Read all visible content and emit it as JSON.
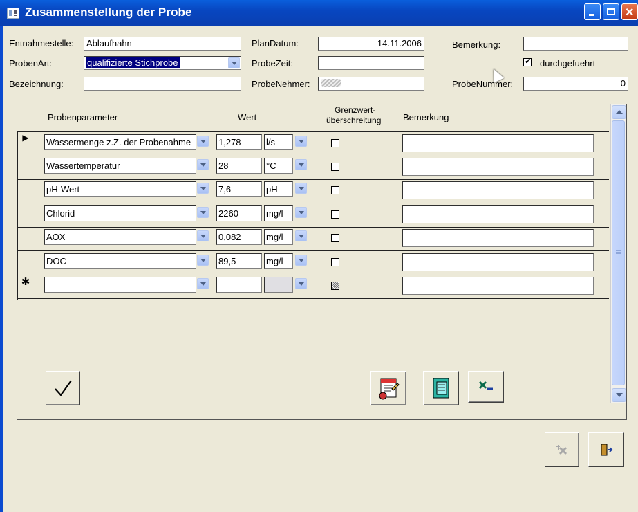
{
  "window": {
    "title": "Zusammenstellung der Probe"
  },
  "form": {
    "entnahmestelle_label": "Entnahmestelle:",
    "entnahmestelle_value": "Ablaufhahn",
    "probenart_label": "ProbenArt:",
    "probenart_value": "qualifizierte Stichprobe",
    "bezeichnung_label": "Bezeichnung:",
    "bezeichnung_value": "",
    "plandatum_label": "PlanDatum:",
    "plandatum_value": "14.11.2006",
    "probezeit_label": "ProbeZeit:",
    "probezeit_value": "",
    "probenehmer_label": "ProbeNehmer:",
    "probenehmer_value": "",
    "bemerkung_label": "Bemerkung:",
    "bemerkung_value": "",
    "durchgefuehrt_label": "durchgefuehrt",
    "durchgefuehrt_checked": true,
    "probenummer_label": "ProbeNummer:",
    "probenummer_value": "0"
  },
  "subform": {
    "headers": {
      "parameter": "Probenparameter",
      "wert": "Wert",
      "grenzwert_line1": "Grenzwert-",
      "grenzwert_line2": "überschreitung",
      "bemerkung": "Bemerkung"
    },
    "rows": [
      {
        "selector": "▶",
        "parameter": "Wassermenge z.Z. der Probenahme",
        "wert": "1,278",
        "einheit": "l/s",
        "grenzwert": false,
        "bemerkung": ""
      },
      {
        "selector": "",
        "parameter": "Wassertemperatur",
        "wert": "28",
        "einheit": "°C",
        "grenzwert": false,
        "bemerkung": ""
      },
      {
        "selector": "",
        "parameter": "pH-Wert",
        "wert": "7,6",
        "einheit": "pH",
        "grenzwert": false,
        "bemerkung": ""
      },
      {
        "selector": "",
        "parameter": "Chlorid",
        "wert": "2260",
        "einheit": "mg/l",
        "grenzwert": false,
        "bemerkung": ""
      },
      {
        "selector": "",
        "parameter": "AOX",
        "wert": "0,082",
        "einheit": "mg/l",
        "grenzwert": false,
        "bemerkung": ""
      },
      {
        "selector": "",
        "parameter": "DOC",
        "wert": "89,5",
        "einheit": "mg/l",
        "grenzwert": false,
        "bemerkung": ""
      },
      {
        "selector": "✱",
        "parameter": "",
        "wert": "",
        "einheit": "",
        "grenzwert": null,
        "bemerkung": ""
      }
    ]
  },
  "icons": {
    "confirm": "checkmark-icon",
    "report": "report-edit-icon",
    "notebook": "notebook-icon",
    "excel": "excel-icon",
    "delete": "delete-record-icon",
    "exit": "exit-door-icon"
  },
  "colors": {
    "titlebar": "#0a5fdc",
    "background": "#ece9d8",
    "selection": "#000080"
  }
}
